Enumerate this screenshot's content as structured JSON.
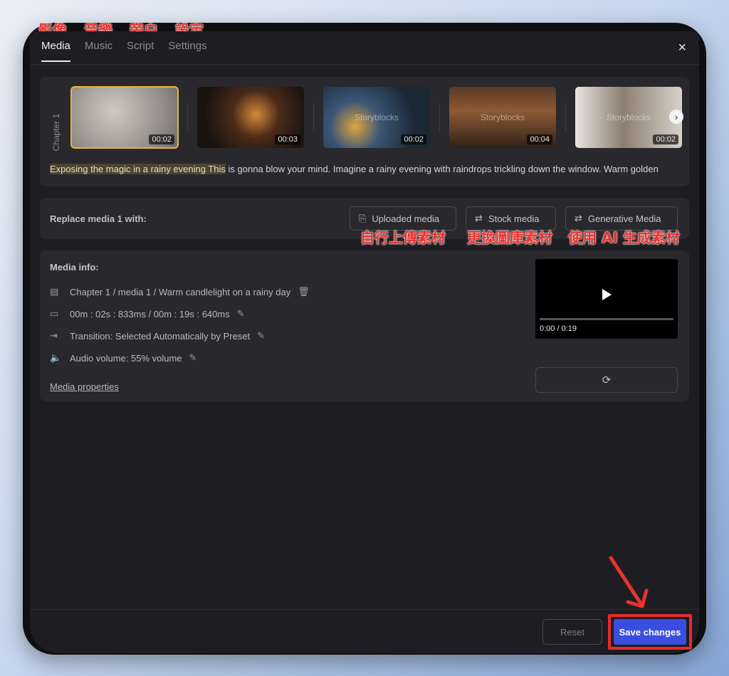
{
  "annotations": {
    "tab_media": "影像",
    "tab_music": "音樂",
    "tab_script": "旁白",
    "tab_settings": "設定",
    "uploaded": "自行上傳素材",
    "stock": "更換圖庫素材",
    "generative": "使用 AI 生成素材"
  },
  "tabs": {
    "media": "Media",
    "music": "Music",
    "script": "Script",
    "settings": "Settings"
  },
  "close_icon": "×",
  "chapter": {
    "label": "Chapter 1",
    "thumbnails": [
      {
        "duration": "00:02",
        "watermark": ""
      },
      {
        "duration": "00:03",
        "watermark": ""
      },
      {
        "duration": "00:02",
        "watermark": "Storyblocks"
      },
      {
        "duration": "00:04",
        "watermark": "Storyblocks"
      },
      {
        "duration": "00:02",
        "watermark": "Storyblocks"
      }
    ],
    "next_icon": "›",
    "script_highlight": "Exposing the magic in a rainy evening This",
    "script_rest": " is gonna blow your mind. Imagine a rainy evening with raindrops trickling down the window. Warm golden"
  },
  "replace": {
    "label": "Replace media 1 with:",
    "uploaded": "Uploaded media",
    "stock": "Stock media",
    "generative": "Generative Media"
  },
  "info": {
    "title": "Media info:",
    "path": "Chapter 1 / media 1 / Warm candlelight on a rainy day",
    "timing": "00m : 02s : 833ms / 00m : 19s : 640ms",
    "transition": "Transition: Selected Automatically by Preset",
    "volume": "Audio volume: 55% volume",
    "properties_link": "Media properties",
    "video_time": "0:00 / 0:19"
  },
  "footer": {
    "reset": "Reset",
    "save": "Save changes"
  },
  "colors": {
    "accent": "#3a4ee0",
    "annotation": "#e8332f",
    "selected_outline": "#e5b73b"
  }
}
